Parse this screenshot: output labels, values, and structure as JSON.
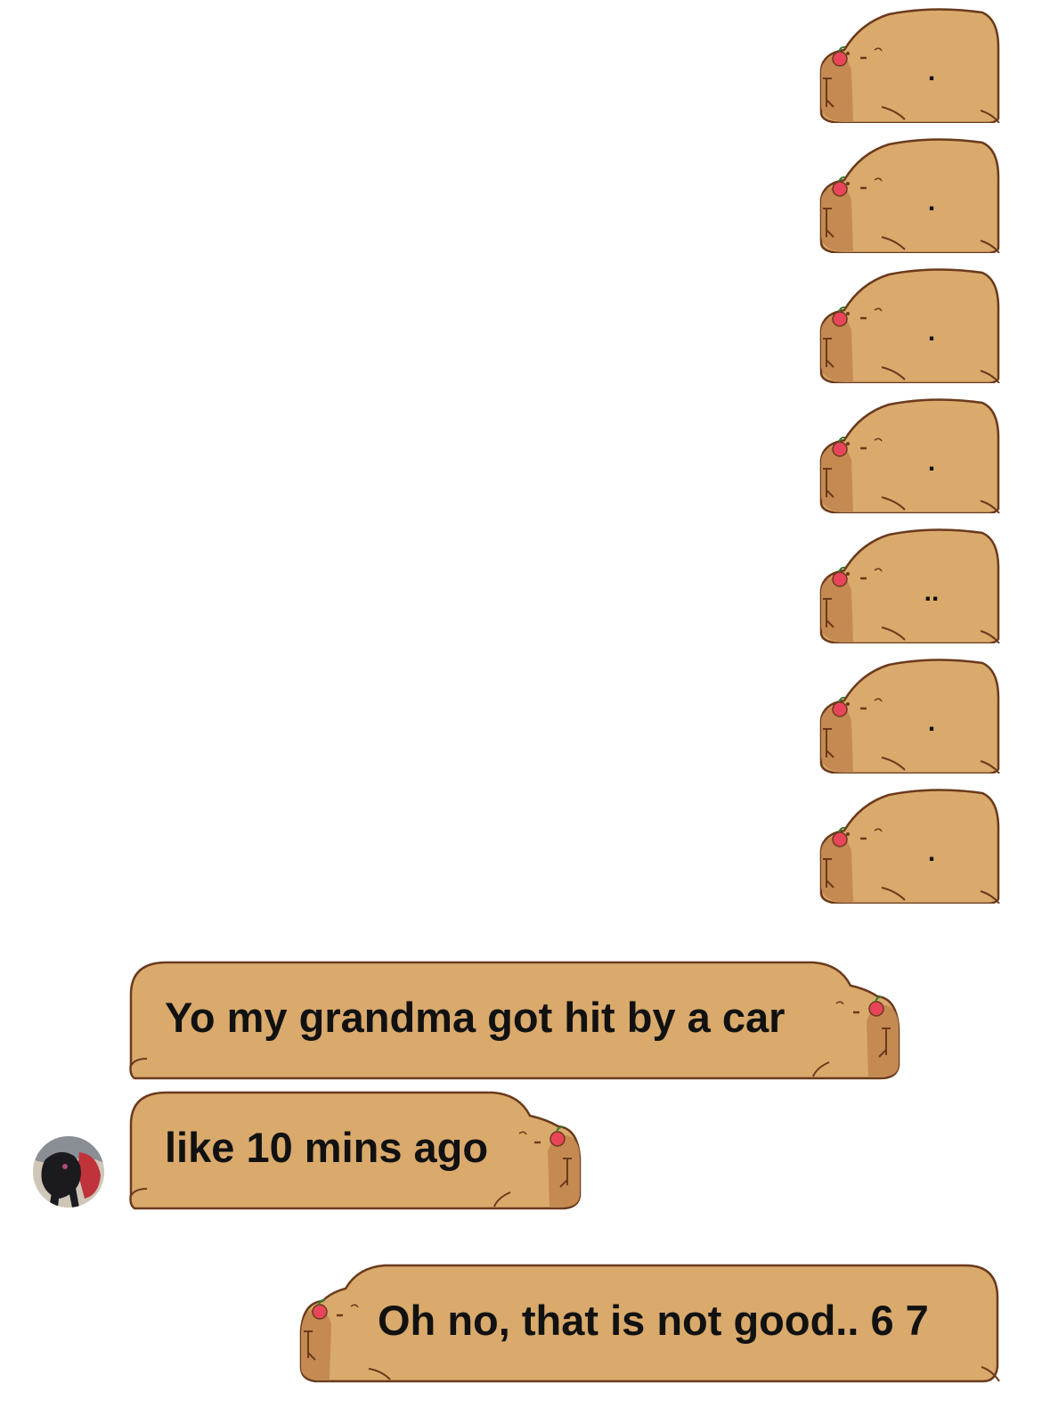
{
  "conversation": {
    "sent_dots": [
      ".",
      ".",
      ".",
      ".",
      "..",
      ".",
      "."
    ],
    "received": [
      {
        "text": "Yo my grandma got hit by a car"
      },
      {
        "text": "like 10 mins ago"
      }
    ],
    "reply": {
      "text": "Oh no, that is not good.. 6 7"
    }
  },
  "theme": {
    "bubble_color": "#d9aa6c",
    "bubble_outline": "#6b3a1c",
    "capybara_face": "#c58a52",
    "cherry_color": "#e8455a",
    "background": "#ffffff"
  },
  "icons": {
    "bubble_decoration": "capybara-icon",
    "avatar": "contact-avatar"
  }
}
